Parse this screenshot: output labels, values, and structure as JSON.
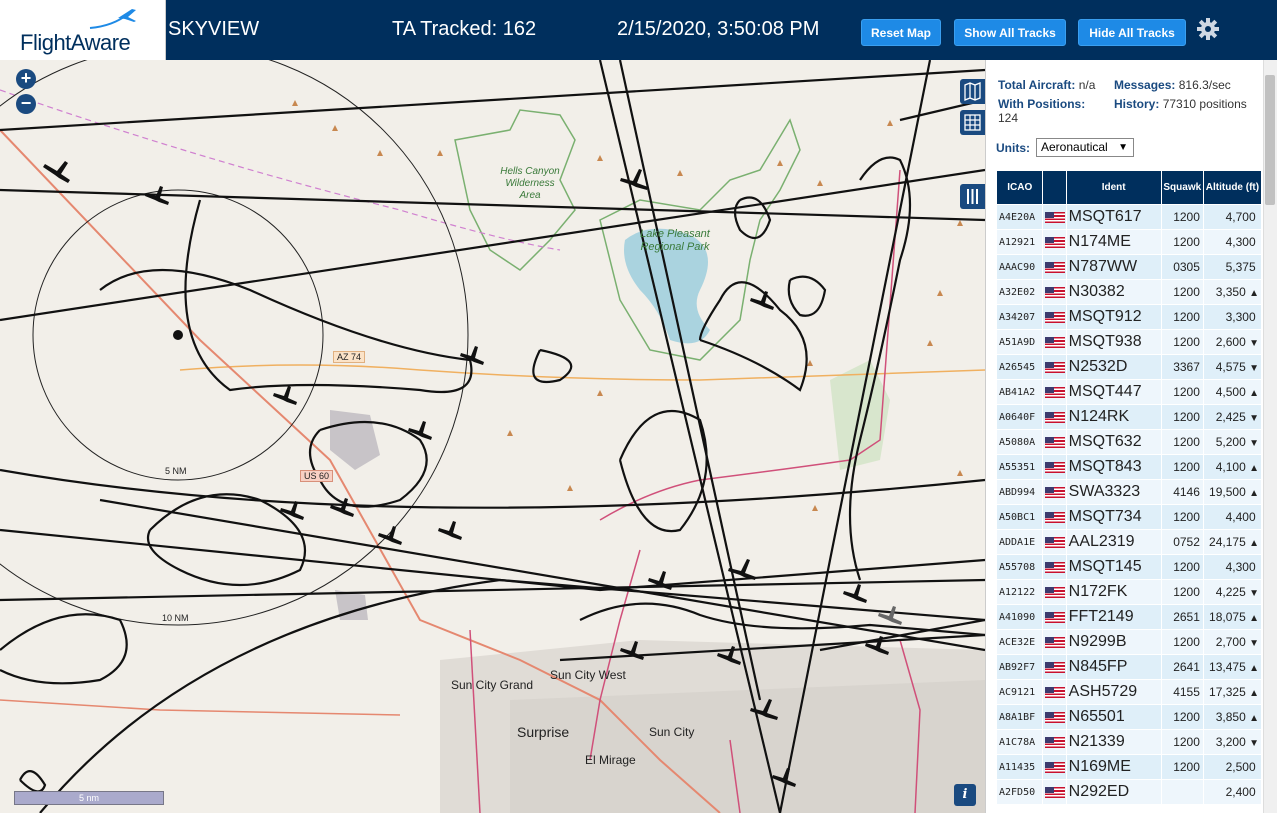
{
  "header": {
    "logo_text": "FlightAware",
    "app_name": "SKYVIEW",
    "tracked": "TA Tracked: 162",
    "datetime": "2/15/2020, 3:50:08 PM",
    "reset_map": "Reset Map",
    "show_all": "Show All Tracks",
    "hide_all": "Hide All Tracks"
  },
  "map": {
    "zoom_in": "+",
    "zoom_out": "−",
    "scale_label": "5 nm",
    "info": "i",
    "ring_5nm": "5 NM",
    "ring_10nm": "10 NM",
    "labels": {
      "hells_canyon": "Hells Canyon Wilderness Area",
      "lake_pleasant": "Lake Pleasant Regional Park",
      "sun_city_grand": "Sun City Grand",
      "sun_city_west": "Sun City West",
      "surprise": "Surprise",
      "sun_city": "Sun City",
      "el_mirage": "El Mirage",
      "az74": "AZ 74",
      "us60": "US 60"
    }
  },
  "stats": {
    "total_label": "Total Aircraft:",
    "total_value": "n/a",
    "messages_label": "Messages:",
    "messages_value": "816.3/sec",
    "with_pos_label": "With Positions:",
    "with_pos_value": "124",
    "history_label": "History:",
    "history_value": "77310 positions"
  },
  "units": {
    "label": "Units:",
    "selected": "Aeronautical"
  },
  "table": {
    "headers": [
      "ICAO",
      "",
      "Ident",
      "Squawk",
      "Altitude (ft)"
    ],
    "rows": [
      {
        "icao": "A4E20A",
        "ident": "MSQT617",
        "squawk": "1200",
        "alt": "4,700",
        "trend": ""
      },
      {
        "icao": "A12921",
        "ident": "N174ME",
        "squawk": "1200",
        "alt": "4,300",
        "trend": ""
      },
      {
        "icao": "AAAC90",
        "ident": "N787WW",
        "squawk": "0305",
        "alt": "5,375",
        "trend": ""
      },
      {
        "icao": "A32E02",
        "ident": "N30382",
        "squawk": "1200",
        "alt": "3,350",
        "trend": "▲"
      },
      {
        "icao": "A34207",
        "ident": "MSQT912",
        "squawk": "1200",
        "alt": "3,300",
        "trend": ""
      },
      {
        "icao": "A51A9D",
        "ident": "MSQT938",
        "squawk": "1200",
        "alt": "2,600",
        "trend": "▼"
      },
      {
        "icao": "A26545",
        "ident": "N2532D",
        "squawk": "3367",
        "alt": "4,575",
        "trend": "▼"
      },
      {
        "icao": "AB41A2",
        "ident": "MSQT447",
        "squawk": "1200",
        "alt": "4,500",
        "trend": "▲"
      },
      {
        "icao": "A0640F",
        "ident": "N124RK",
        "squawk": "1200",
        "alt": "2,425",
        "trend": "▼"
      },
      {
        "icao": "A5080A",
        "ident": "MSQT632",
        "squawk": "1200",
        "alt": "5,200",
        "trend": "▼"
      },
      {
        "icao": "A55351",
        "ident": "MSQT843",
        "squawk": "1200",
        "alt": "4,100",
        "trend": "▲"
      },
      {
        "icao": "ABD994",
        "ident": "SWA3323",
        "squawk": "4146",
        "alt": "19,500",
        "trend": "▲"
      },
      {
        "icao": "A50BC1",
        "ident": "MSQT734",
        "squawk": "1200",
        "alt": "4,400",
        "trend": ""
      },
      {
        "icao": "ADDA1E",
        "ident": "AAL2319",
        "squawk": "0752",
        "alt": "24,175",
        "trend": "▲"
      },
      {
        "icao": "A55708",
        "ident": "MSQT145",
        "squawk": "1200",
        "alt": "4,300",
        "trend": ""
      },
      {
        "icao": "A12122",
        "ident": "N172FK",
        "squawk": "1200",
        "alt": "4,225",
        "trend": "▼"
      },
      {
        "icao": "A41090",
        "ident": "FFT2149",
        "squawk": "2651",
        "alt": "18,075",
        "trend": "▲"
      },
      {
        "icao": "ACE32E",
        "ident": "N9299B",
        "squawk": "1200",
        "alt": "2,700",
        "trend": "▼"
      },
      {
        "icao": "AB92F7",
        "ident": "N845FP",
        "squawk": "2641",
        "alt": "13,475",
        "trend": "▲"
      },
      {
        "icao": "AC9121",
        "ident": "ASH5729",
        "squawk": "4155",
        "alt": "17,325",
        "trend": "▲"
      },
      {
        "icao": "A8A1BF",
        "ident": "N65501",
        "squawk": "1200",
        "alt": "3,850",
        "trend": "▲"
      },
      {
        "icao": "A1C78A",
        "ident": "N21339",
        "squawk": "1200",
        "alt": "3,200",
        "trend": "▼"
      },
      {
        "icao": "A11435",
        "ident": "N169ME",
        "squawk": "1200",
        "alt": "2,500",
        "trend": ""
      },
      {
        "icao": "A2FD50",
        "ident": "N292ED",
        "squawk": "",
        "alt": "2,400",
        "trend": ""
      }
    ]
  },
  "colors": {
    "header_bg": "#002f5d",
    "button": "#1e8ae6",
    "table_header": "#002f5d",
    "row_a": "#dfeff9",
    "row_b": "#eef6fc",
    "track": "#111111"
  }
}
